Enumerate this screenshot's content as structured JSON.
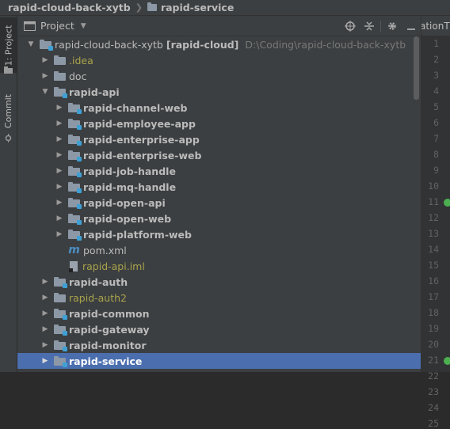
{
  "breadcrumb": {
    "root": "rapid-cloud-back-xytb",
    "child": "rapid-service"
  },
  "left_tabs": {
    "project": "1: Project",
    "commit": "Commit"
  },
  "panel": {
    "title": "Project",
    "tools": [
      "locate-icon",
      "collapse-icon",
      "settings-icon",
      "hide-icon"
    ]
  },
  "tree": [
    {
      "level": 0,
      "arrow": "down",
      "icon": "module-folder",
      "label": "rapid-cloud-back-xytb",
      "tag": "[rapid-cloud]",
      "path": "D:\\Coding\\rapid-cloud-back-xytb",
      "style": "normal"
    },
    {
      "level": 1,
      "arrow": "right",
      "icon": "folder",
      "label": ".idea",
      "style": "olive"
    },
    {
      "level": 1,
      "arrow": "right",
      "icon": "folder",
      "label": "doc",
      "style": "normal"
    },
    {
      "level": 1,
      "arrow": "down",
      "icon": "module-folder",
      "label": "rapid-api",
      "style": "bold"
    },
    {
      "level": 2,
      "arrow": "right",
      "icon": "module-folder",
      "label": "rapid-channel-web",
      "style": "bold"
    },
    {
      "level": 2,
      "arrow": "right",
      "icon": "module-folder",
      "label": "rapid-employee-app",
      "style": "bold"
    },
    {
      "level": 2,
      "arrow": "right",
      "icon": "module-folder",
      "label": "rapid-enterprise-app",
      "style": "bold"
    },
    {
      "level": 2,
      "arrow": "right",
      "icon": "module-folder",
      "label": "rapid-enterprise-web",
      "style": "bold"
    },
    {
      "level": 2,
      "arrow": "right",
      "icon": "module-folder",
      "label": "rapid-job-handle",
      "style": "bold"
    },
    {
      "level": 2,
      "arrow": "right",
      "icon": "module-folder",
      "label": "rapid-mq-handle",
      "style": "bold"
    },
    {
      "level": 2,
      "arrow": "right",
      "icon": "module-folder",
      "label": "rapid-open-api",
      "style": "bold"
    },
    {
      "level": 2,
      "arrow": "right",
      "icon": "module-folder",
      "label": "rapid-open-web",
      "style": "bold"
    },
    {
      "level": 2,
      "arrow": "right",
      "icon": "module-folder",
      "label": "rapid-platform-web",
      "style": "bold"
    },
    {
      "level": 2,
      "arrow": "none",
      "icon": "maven",
      "label": "pom.xml",
      "style": "normal"
    },
    {
      "level": 2,
      "arrow": "none",
      "icon": "iml",
      "label": "rapid-api.iml",
      "style": "olive"
    },
    {
      "level": 1,
      "arrow": "right",
      "icon": "module-folder",
      "label": "rapid-auth",
      "style": "bold"
    },
    {
      "level": 1,
      "arrow": "right",
      "icon": "folder",
      "label": "rapid-auth2",
      "style": "olive"
    },
    {
      "level": 1,
      "arrow": "right",
      "icon": "module-folder",
      "label": "rapid-common",
      "style": "bold"
    },
    {
      "level": 1,
      "arrow": "right",
      "icon": "module-folder",
      "label": "rapid-gateway",
      "style": "bold"
    },
    {
      "level": 1,
      "arrow": "right",
      "icon": "module-folder",
      "label": "rapid-monitor",
      "style": "bold"
    },
    {
      "level": 1,
      "arrow": "right",
      "icon": "module-folder",
      "label": "rapid-service",
      "style": "bold",
      "selected": true
    }
  ],
  "editor": {
    "tab_label": "ationT",
    "line_numbers": [
      "1",
      "2",
      "3",
      "4",
      "5",
      "6",
      "7",
      "8",
      "9",
      "10",
      "11",
      "12",
      "13",
      "14",
      "15",
      "16",
      "17",
      "18",
      "19",
      "20",
      "21",
      "22",
      "23",
      "24",
      "25"
    ],
    "gutter_icon_lines": [
      11,
      21
    ]
  },
  "colors": {
    "selection": "#4b6eaf",
    "excluded_text": "#a8a34a",
    "background": "#3c3f41"
  }
}
